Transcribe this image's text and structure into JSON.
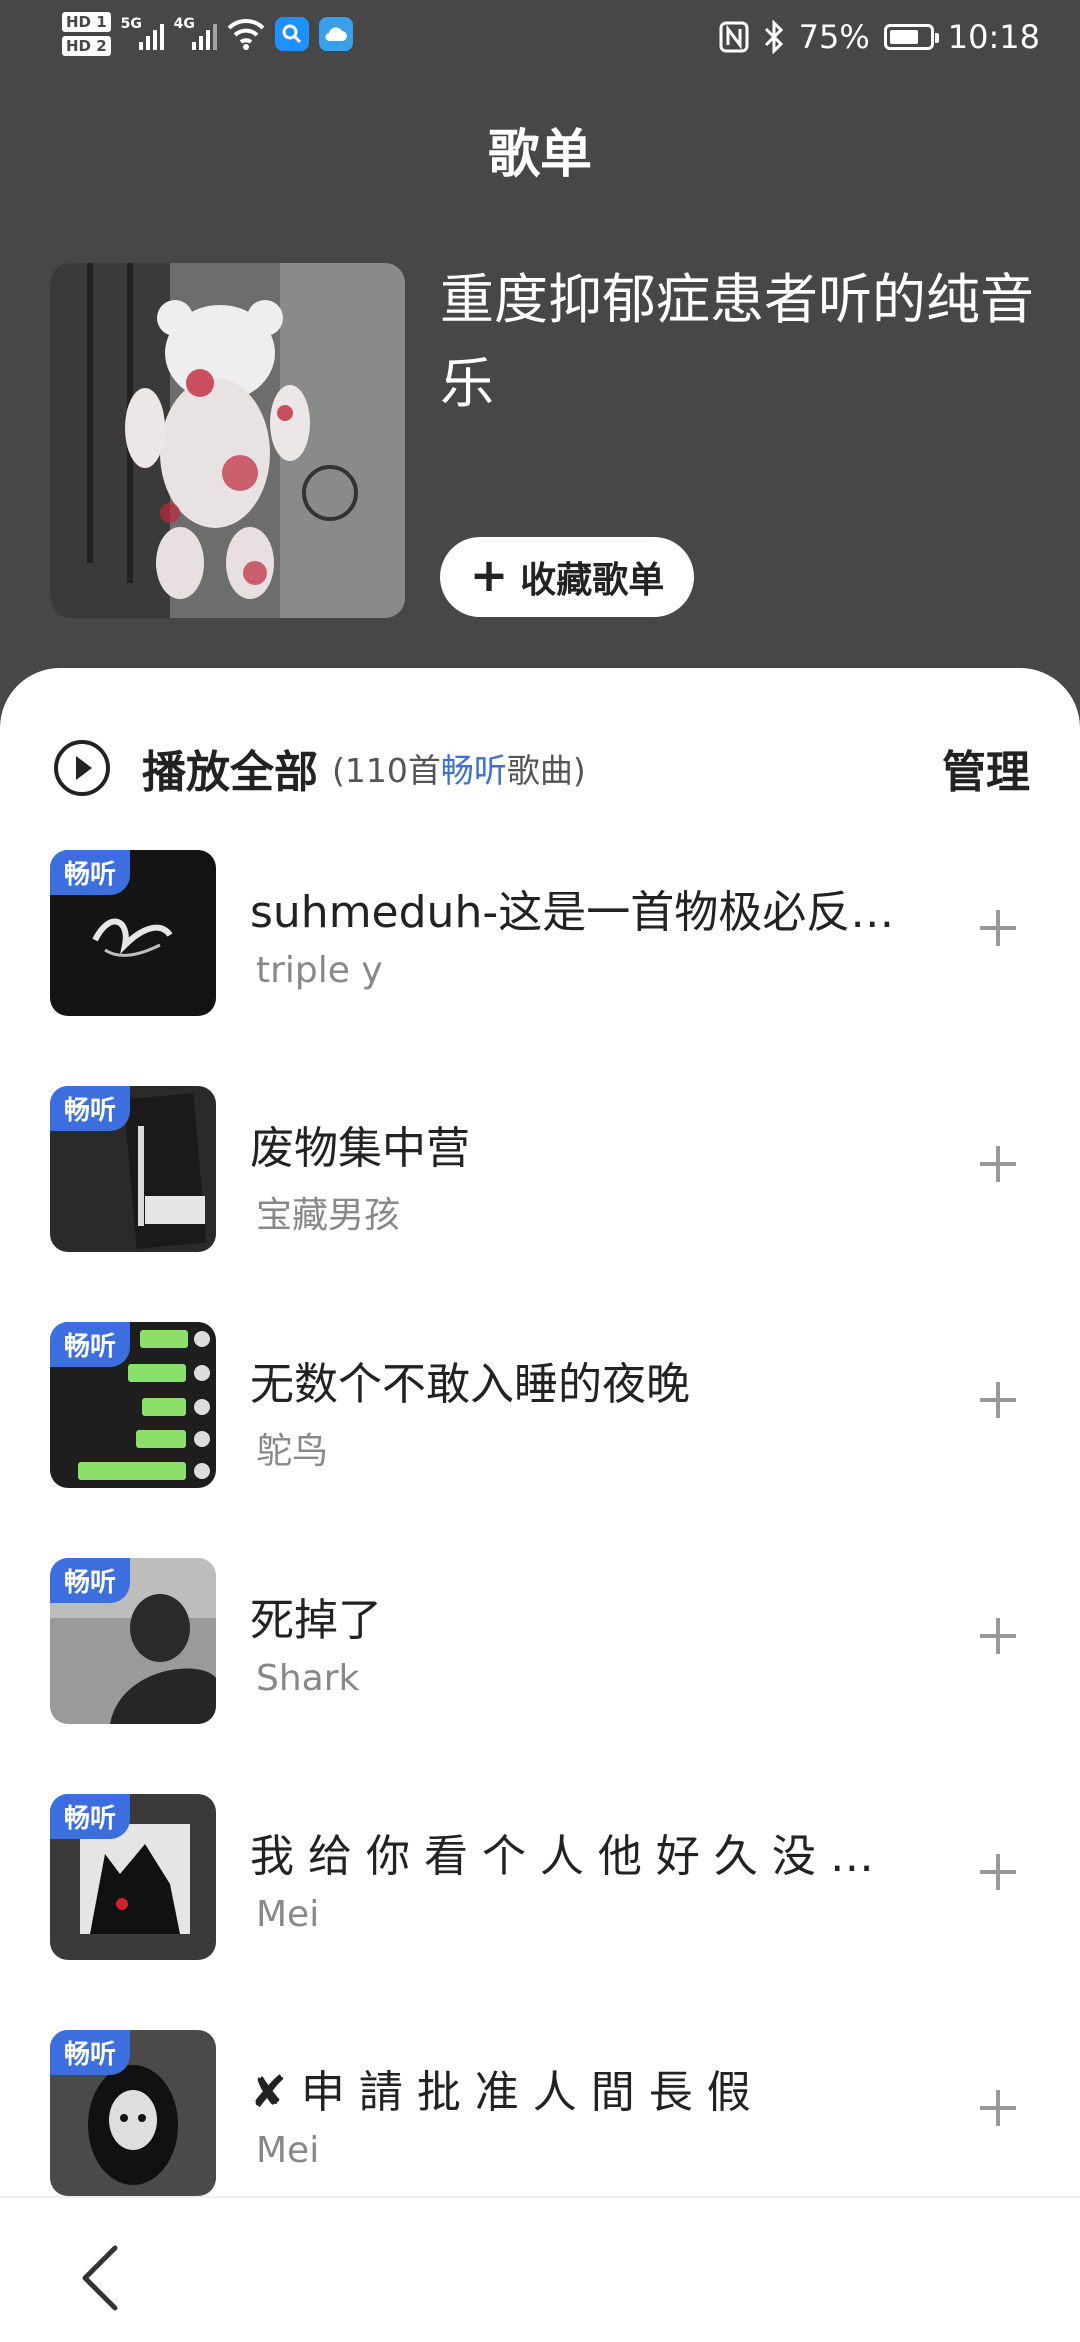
{
  "status_bar": {
    "hd1": "HD 1",
    "hd2": "HD 2",
    "net1": "5G",
    "net2": "4G",
    "battery_pct": "75%",
    "time": "10:18",
    "battery_level": 0.75
  },
  "page": {
    "title": "歌单"
  },
  "playlist": {
    "title": "重度抑郁症患者听的纯音乐",
    "fav_label": "收藏歌单"
  },
  "list_header": {
    "play_all": "播放全部",
    "count_prefix": "(110首",
    "count_highlight": "畅听",
    "count_suffix": "歌曲)",
    "manage": "管理"
  },
  "songs": [
    {
      "tag": "畅听",
      "title": "suhmeduh-这是一首物极必反…",
      "artist": "triple y"
    },
    {
      "tag": "畅听",
      "title": "废物集中营",
      "artist": "宝藏男孩"
    },
    {
      "tag": "畅听",
      "title": "无数个不敢入睡的夜晚",
      "artist": "鸵鸟"
    },
    {
      "tag": "畅听",
      "title": "死掉了",
      "artist": "Shark"
    },
    {
      "tag": "畅听",
      "title": "我 给 你 看 个 人 他 好 久 没 …",
      "artist": "Mei"
    },
    {
      "tag": "畅听",
      "title": "✘ 申 請 批 准 人 間 長 假",
      "artist": "Mei"
    }
  ],
  "colors": {
    "header_bg": "#474747",
    "tag_bg": "#3d6ee0",
    "highlight": "#3f6fd6"
  },
  "icons": [
    "play-circle-icon",
    "plus-icon",
    "back-chevron-icon",
    "nfc-icon",
    "bluetooth-icon",
    "wifi-icon"
  ]
}
